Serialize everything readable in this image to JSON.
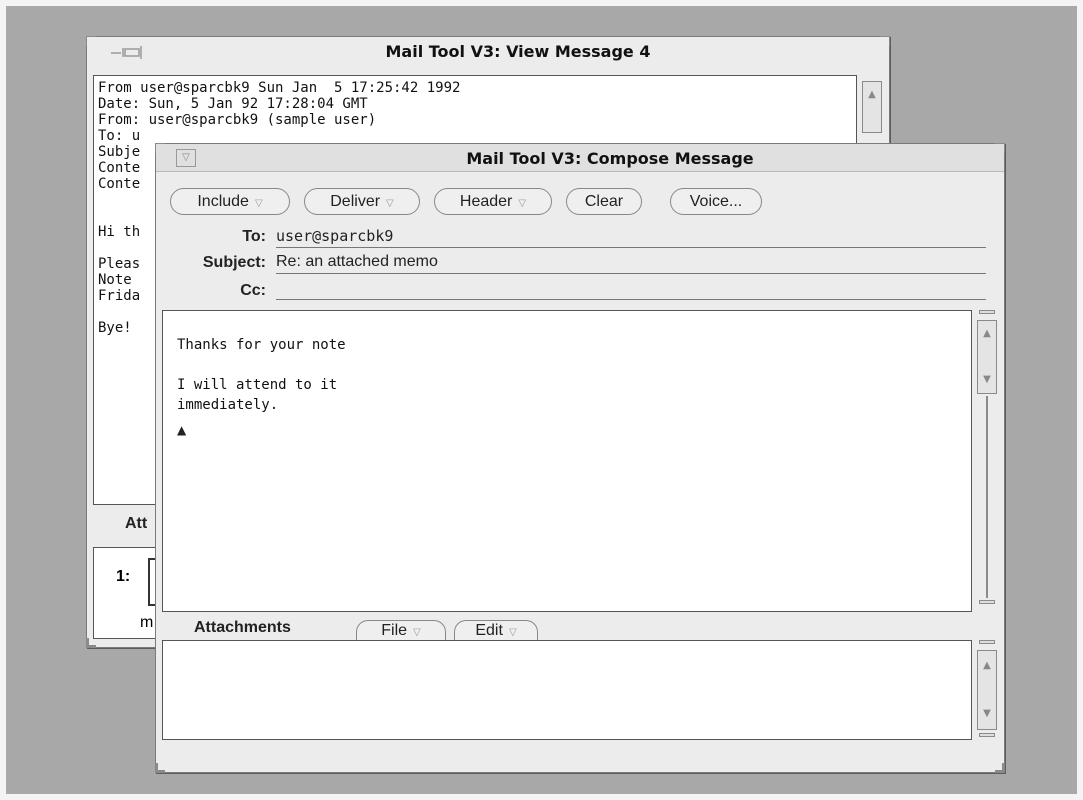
{
  "view_window": {
    "title": "Mail Tool V3: View Message 4",
    "message_lines": [
      "From user@sparcbk9 Sun Jan  5 17:25:42 1992",
      "Date: Sun, 5 Jan 92 17:28:04 GMT",
      "From: user@sparcbk9 (sample user)",
      "To: u",
      "Subje",
      "Conte",
      "Conte",
      "Hi th",
      "Pleas",
      "Note",
      "Frida",
      "Bye!"
    ],
    "attachments_label": "Att",
    "attachment_index": "1:",
    "attachment_caption": "m"
  },
  "compose_window": {
    "title": "Mail Tool V3: Compose Message",
    "menu_glyph": "▽",
    "toolbar": {
      "include_label": "Include",
      "deliver_label": "Deliver",
      "header_label": "Header",
      "clear_label": "Clear",
      "voice_label": "Voice...",
      "menu_arrow": "▽"
    },
    "header": {
      "to_label": "To:",
      "to_value": "user@sparcbk9",
      "subject_label": "Subject:",
      "subject_value": "Re: an attached memo",
      "cc_label": "Cc:",
      "cc_value": ""
    },
    "body_lines": [
      "Thanks for your note",
      "",
      "I will attend to it",
      "immediately."
    ],
    "caret": "▲",
    "attachments": {
      "label": "Attachments",
      "file_label": "File",
      "edit_label": "Edit",
      "menu_arrow": "▽"
    }
  },
  "colors": {
    "desktop": "#a8a8a8",
    "window": "#ececec",
    "text_pane": "#ffffff"
  },
  "icons": [
    "window-menu-icon",
    "pushpin-icon",
    "scroll-up-arrow-icon",
    "scroll-down-arrow-icon",
    "insertion-caret-icon"
  ]
}
